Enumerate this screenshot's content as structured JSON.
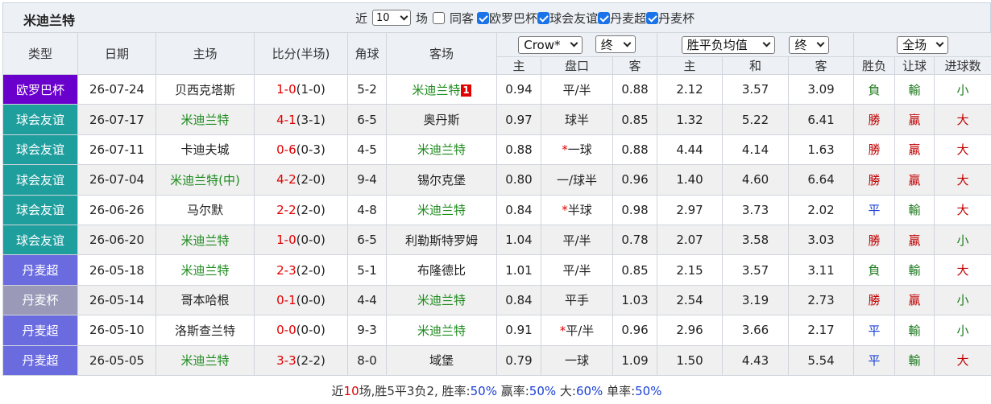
{
  "title": "米迪兰特",
  "filters": {
    "recent_prefix": "近",
    "recent_value": "10",
    "recent_suffix": "场",
    "same_host_label": "同客",
    "competitions": [
      "欧罗巴杯",
      "球会友谊",
      "丹麦超",
      "丹麦杯"
    ]
  },
  "headers": {
    "type": "类型",
    "date": "日期",
    "home": "主场",
    "score": "比分(半场)",
    "corners": "角球",
    "away": "客场",
    "handicap_company": "Crow*",
    "handicap_mode": "终",
    "odds_type": "胜平负均值",
    "odds_mode": "终",
    "scope": "全场",
    "sub": {
      "h_home": "主",
      "h_line": "盘口",
      "h_away": "客",
      "o_home": "主",
      "o_draw": "和",
      "o_away": "客",
      "result": "胜负",
      "handicap_result": "让球",
      "goals_result": "进球数"
    }
  },
  "colors": {
    "欧罗巴杯": "#6a00cc",
    "球会友谊": "#1f9e9e",
    "丹麦超": "#6b6be0",
    "丹麦杯": "#9a9ab8"
  },
  "rows": [
    {
      "type": "欧罗巴杯",
      "date": "26-07-24",
      "home": "贝西克塔斯",
      "home_hl": false,
      "score": "1-0",
      "half": "(1-0)",
      "corners": "5-2",
      "away": "米迪兰特",
      "away_hl": true,
      "away_badge": "1",
      "hh": "0.94",
      "line": "平/半",
      "line_star": "",
      "ha": "0.88",
      "oh": "2.12",
      "od": "3.57",
      "oa": "3.09",
      "res": "負",
      "res_c": "darkgreen",
      "hres": "輸",
      "hres_c": "darkgreen",
      "gres": "小",
      "gres_c": "darkgreen"
    },
    {
      "type": "球会友谊",
      "date": "26-07-17",
      "home": "米迪兰特",
      "home_hl": true,
      "score": "4-1",
      "half": "(3-1)",
      "corners": "6-5",
      "away": "奥丹斯",
      "away_hl": false,
      "away_badge": "",
      "hh": "0.97",
      "line": "球半",
      "line_star": "",
      "ha": "0.85",
      "oh": "1.32",
      "od": "5.22",
      "oa": "6.41",
      "res": "勝",
      "res_c": "darkred",
      "hres": "贏",
      "hres_c": "darkred",
      "gres": "大",
      "gres_c": "darkred"
    },
    {
      "type": "球会友谊",
      "date": "26-07-11",
      "home": "卡迪夫城",
      "home_hl": false,
      "score": "0-6",
      "half": "(0-3)",
      "corners": "4-5",
      "away": "米迪兰特",
      "away_hl": true,
      "away_badge": "",
      "hh": "0.88",
      "line": "一球",
      "line_star": "*",
      "ha": "0.88",
      "oh": "4.44",
      "od": "4.14",
      "oa": "1.63",
      "res": "勝",
      "res_c": "darkred",
      "hres": "贏",
      "hres_c": "darkred",
      "gres": "大",
      "gres_c": "darkred"
    },
    {
      "type": "球会友谊",
      "date": "26-07-04",
      "home": "米迪兰特(中)",
      "home_hl": true,
      "score": "4-2",
      "half": "(2-0)",
      "corners": "9-4",
      "away": "锡尔克堡",
      "away_hl": false,
      "away_badge": "",
      "hh": "0.80",
      "line": "一/球半",
      "line_star": "",
      "ha": "0.96",
      "oh": "1.40",
      "od": "4.60",
      "oa": "6.64",
      "res": "勝",
      "res_c": "darkred",
      "hres": "贏",
      "hres_c": "darkred",
      "gres": "大",
      "gres_c": "darkred"
    },
    {
      "type": "球会友谊",
      "date": "26-06-26",
      "home": "马尔默",
      "home_hl": false,
      "score": "2-2",
      "half": "(2-0)",
      "corners": "4-8",
      "away": "米迪兰特",
      "away_hl": true,
      "away_badge": "",
      "hh": "0.84",
      "line": "半球",
      "line_star": "*",
      "ha": "0.98",
      "oh": "2.97",
      "od": "3.73",
      "oa": "2.02",
      "res": "平",
      "res_c": "blue",
      "hres": "輸",
      "hres_c": "darkgreen",
      "gres": "大",
      "gres_c": "darkred"
    },
    {
      "type": "球会友谊",
      "date": "26-06-20",
      "home": "米迪兰特",
      "home_hl": true,
      "score": "1-0",
      "half": "(0-0)",
      "corners": "6-5",
      "away": "利勒斯特罗姆",
      "away_hl": false,
      "away_badge": "",
      "hh": "1.04",
      "line": "平/半",
      "line_star": "",
      "ha": "0.78",
      "oh": "2.07",
      "od": "3.58",
      "oa": "3.03",
      "res": "勝",
      "res_c": "darkred",
      "hres": "贏",
      "hres_c": "darkred",
      "gres": "小",
      "gres_c": "darkgreen"
    },
    {
      "type": "丹麦超",
      "date": "26-05-18",
      "home": "米迪兰特",
      "home_hl": true,
      "score": "2-3",
      "half": "(2-0)",
      "corners": "5-1",
      "away": "布隆德比",
      "away_hl": false,
      "away_badge": "",
      "hh": "1.01",
      "line": "平/半",
      "line_star": "",
      "ha": "0.85",
      "oh": "2.15",
      "od": "3.57",
      "oa": "3.11",
      "res": "負",
      "res_c": "darkgreen",
      "hres": "輸",
      "hres_c": "darkgreen",
      "gres": "大",
      "gres_c": "darkred"
    },
    {
      "type": "丹麦杯",
      "date": "26-05-14",
      "home": "哥本哈根",
      "home_hl": false,
      "score": "0-1",
      "half": "(0-0)",
      "corners": "4-4",
      "away": "米迪兰特",
      "away_hl": true,
      "away_badge": "",
      "hh": "0.84",
      "line": "平手",
      "line_star": "",
      "ha": "1.03",
      "oh": "2.54",
      "od": "3.19",
      "oa": "2.73",
      "res": "勝",
      "res_c": "darkred",
      "hres": "贏",
      "hres_c": "darkred",
      "gres": "小",
      "gres_c": "darkgreen"
    },
    {
      "type": "丹麦超",
      "date": "26-05-10",
      "home": "洛斯查兰特",
      "home_hl": false,
      "score": "0-0",
      "half": "(0-0)",
      "corners": "9-3",
      "away": "米迪兰特",
      "away_hl": true,
      "away_badge": "",
      "hh": "0.91",
      "line": "平/半",
      "line_star": "*",
      "ha": "0.96",
      "oh": "2.96",
      "od": "3.66",
      "oa": "2.17",
      "res": "平",
      "res_c": "blue",
      "hres": "輸",
      "hres_c": "darkgreen",
      "gres": "小",
      "gres_c": "darkgreen"
    },
    {
      "type": "丹麦超",
      "date": "26-05-05",
      "home": "米迪兰特",
      "home_hl": true,
      "score": "3-3",
      "half": "(2-2)",
      "corners": "8-0",
      "away": "域堡",
      "away_hl": false,
      "away_badge": "",
      "hh": "0.79",
      "line": "一球",
      "line_star": "",
      "ha": "1.09",
      "oh": "1.50",
      "od": "4.43",
      "oa": "5.54",
      "res": "平",
      "res_c": "blue",
      "hres": "輸",
      "hres_c": "darkgreen",
      "gres": "大",
      "gres_c": "darkred"
    }
  ],
  "summary": {
    "p1": "近",
    "count": "10",
    "p2": "场,胜5平3负2, 胜率:",
    "win_rate": "50%",
    "p3": " 赢率:",
    "cover_rate": "50%",
    "p4": " 大:",
    "over_rate": "60%",
    "p5": " 单率:",
    "odd_rate": "50%"
  }
}
